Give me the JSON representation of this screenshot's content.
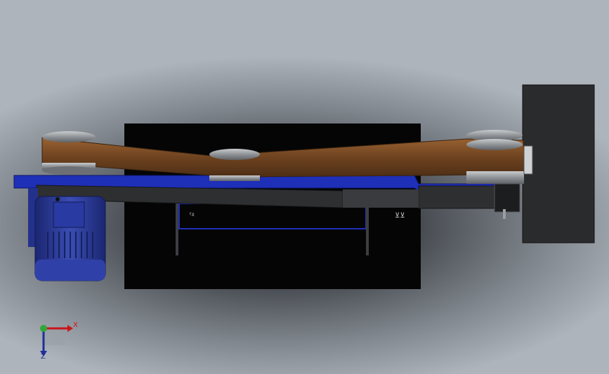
{
  "viewport": {
    "background": "#aeb4bb",
    "model_colors": {
      "belt": "#7a4a22",
      "frame_blue": "#1e2fb8",
      "arm_dark": "#2e2f31",
      "pulley": "#8f9397",
      "base_black": "#050505",
      "motor_blue": "#2b3b9a"
    }
  },
  "triad": {
    "x_label": "X",
    "z_label": "Z",
    "x_color": "#c8161d",
    "y_color": "#2fa83a",
    "z_color": "#1e2f9a"
  }
}
